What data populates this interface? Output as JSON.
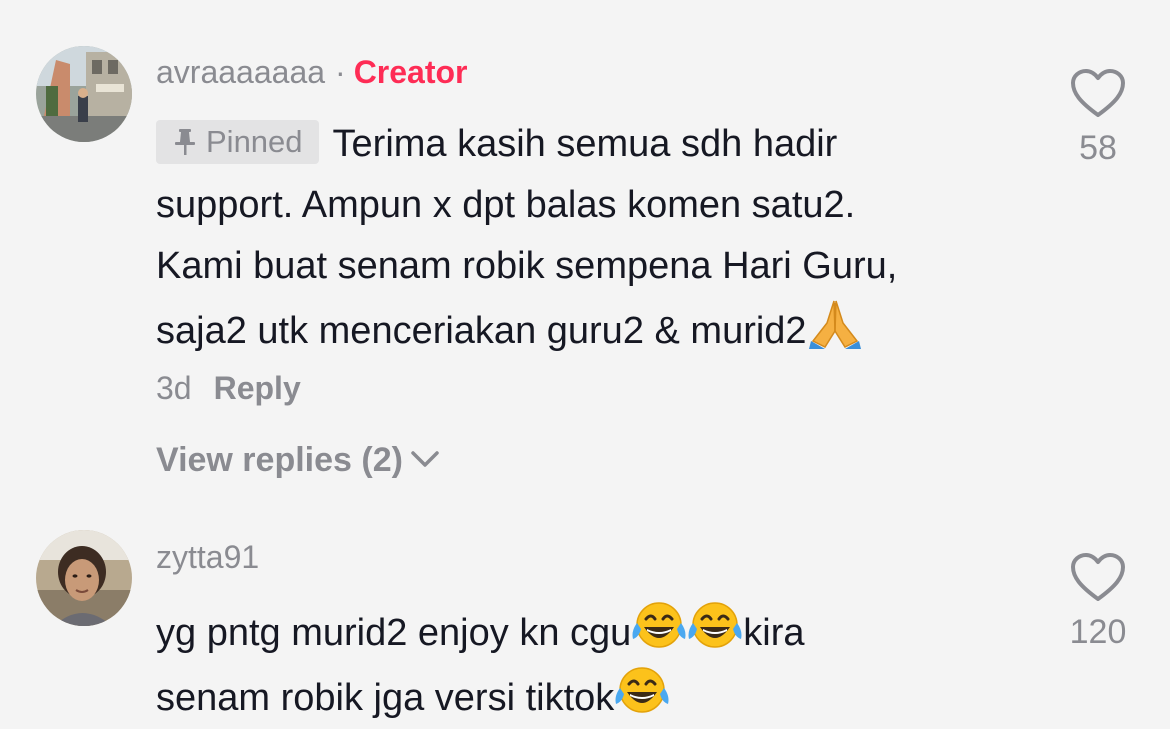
{
  "comments": [
    {
      "username": "avraaaaaaa",
      "separator": "·",
      "badge": "Creator",
      "pinned_label": "Pinned",
      "lines": [
        "Terima kasih semua sdh hadir",
        "support. Ampun x dpt balas komen satu2.",
        "Kami buat senam robik sempena Hari Guru,",
        "saja2 utk menceriakan guru2 & murid2"
      ],
      "emoji": "folded-hands",
      "age": "3d",
      "reply_label": "Reply",
      "view_replies": "View replies (2)",
      "likes": "58"
    },
    {
      "username": "zytta91",
      "line1_a": "yg pntg murid2 enjoy kn cgu",
      "line1_b": "kira",
      "line2": "senam robik jga versi tiktok",
      "emoji": "face-with-tears-of-joy",
      "likes": "120"
    }
  ],
  "colors": {
    "background": "#f4f4f4",
    "text": "#161823",
    "muted": "#8a8b91",
    "creator_badge": "#fe2c55",
    "pinned_bg": "#e3e3e4"
  },
  "icons": {
    "like": "heart-outline-icon",
    "pin": "pin-icon",
    "expand": "chevron-down-icon"
  }
}
